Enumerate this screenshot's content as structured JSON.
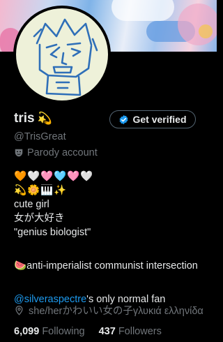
{
  "profile": {
    "display_name": "tris",
    "name_emoji": "💫",
    "handle": "@TrisGreat",
    "parody_label": "Parody account",
    "verify_button": "Get verified"
  },
  "bio": {
    "emoji_row_1": [
      "🧡",
      "🤍",
      "🩷",
      "🩵",
      "🩷",
      "🤍"
    ],
    "emoji_row_2": [
      "💫",
      "🌼",
      "🎹",
      "✨"
    ],
    "line_1": "cute girl",
    "line_2": "女が大好き",
    "line_3": "\"genius biologist\"",
    "line_4_emoji": "🍉",
    "line_4_text": "anti-imperialist communist intersection",
    "mention": "@silveraspectre",
    "mention_suffix": "'s only normal fan"
  },
  "location": "she/herかわいい女の子γλυκιά ελληνίδα",
  "stats": {
    "following_count": "6,099",
    "following_label": "Following",
    "followers_count": "437",
    "followers_label": "Followers"
  },
  "colors": {
    "background": "#000000",
    "text": "#e7e9ea",
    "muted": "#71767b",
    "link": "#1d9bf0",
    "verified_badge": "#1d9bf0"
  }
}
